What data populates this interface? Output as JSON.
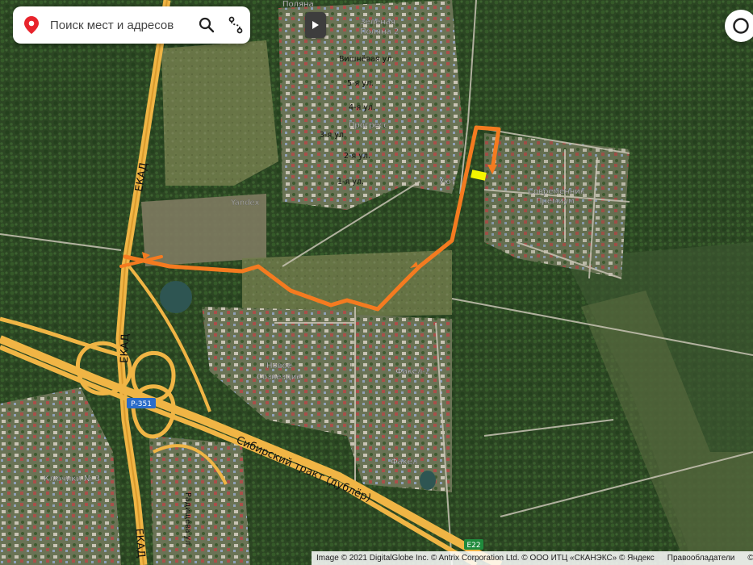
{
  "search": {
    "placeholder": "Поиск мест и адресов",
    "search_icon": "magnifier-icon",
    "route_icon": "route-icon",
    "location_icon": "map-pin-icon"
  },
  "controls": {
    "play_icon": "play-icon",
    "layers_icon": "circle-icon"
  },
  "map": {
    "road_labels": {
      "ekad_top": "ЕКАД",
      "ekad_mid": "ЕКАД",
      "ekad_bottom": "ЕКАД",
      "sib_trakt": "Сибирский тракт (дублёр)",
      "r351": "Р-351",
      "e22": "E22"
    },
    "street_labels": {
      "vishnevaya": "Вишнёвая ул.",
      "s5": "5-я ул.",
      "s4": "4-я ул.",
      "s3": "3-я ул.",
      "s2": "2-я ул.",
      "s1": "1-я ул.",
      "radishcheva": "Радищева ул."
    },
    "area_labels": {
      "zelenaya_polyana": "Зелёная",
      "zelenaya_polyana2": "Поляна 2",
      "polyana": "Поляна",
      "progress": "Прогресс",
      "uyut": "Уют",
      "sovr_premium": "Современник",
      "sovr_premium2": "Премиум",
      "novoe": "Новое",
      "sozvezdie": "Созвездие",
      "fakel2": "Факел-2",
      "fakel": "Факел",
      "klyuchiki": "Ключики № 3",
      "yandex": "Yandex"
    },
    "route_color": "#f47b20",
    "marker_color": "#f5f500",
    "road_color": "#f0b545"
  },
  "copyright": {
    "text": "Image © 2021 DigitalGlobe Inc. © Antrix Corporation Ltd. © ООО ИТЦ «СКАНЭКС» © Яндекс",
    "owners": "Правообладатели",
    "yandex_short": "© Я"
  }
}
